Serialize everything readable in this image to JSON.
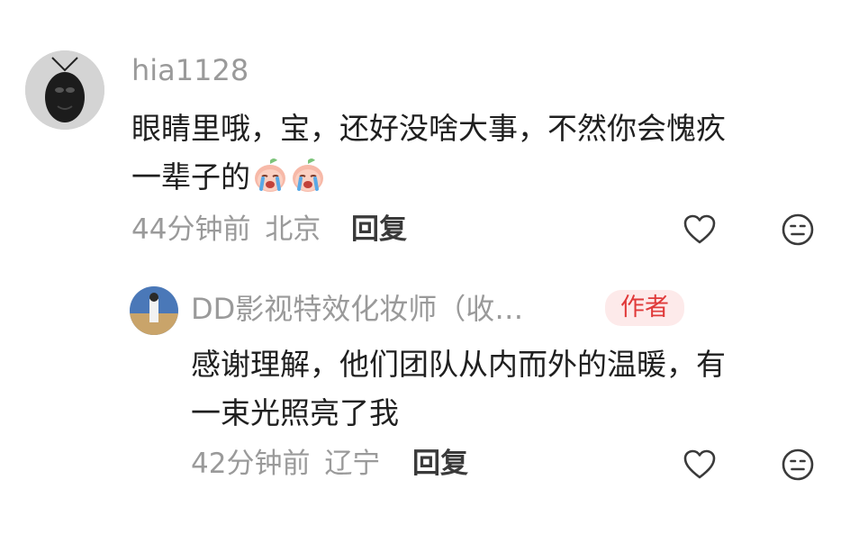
{
  "comment": {
    "username": "hia1128",
    "text_line1": "眼睛里哦，宝，还好没啥大事，不然你会愧疚",
    "text_line2": "一辈子的",
    "emojis": [
      "crying-peach-emoji",
      "crying-peach-emoji"
    ],
    "time": "44分钟前",
    "location": "北京",
    "reply_label": "回复",
    "icons": [
      "heart-icon",
      "dislike-face-icon"
    ]
  },
  "reply": {
    "username": "DD影视特效化妆师（收…",
    "badge": "作者",
    "text_line1": "感谢理解，他们团队从内而外的温暖，有",
    "text_line2": "一束光照亮了我",
    "time": "42分钟前",
    "location": "辽宁",
    "reply_label": "回复",
    "icons": [
      "heart-icon",
      "dislike-face-icon"
    ]
  },
  "colors": {
    "secondary_text": "#9a9a9a",
    "primary_text": "#1f1f1f",
    "badge_bg": "#fdeaea",
    "badge_text": "#e03a3a"
  }
}
